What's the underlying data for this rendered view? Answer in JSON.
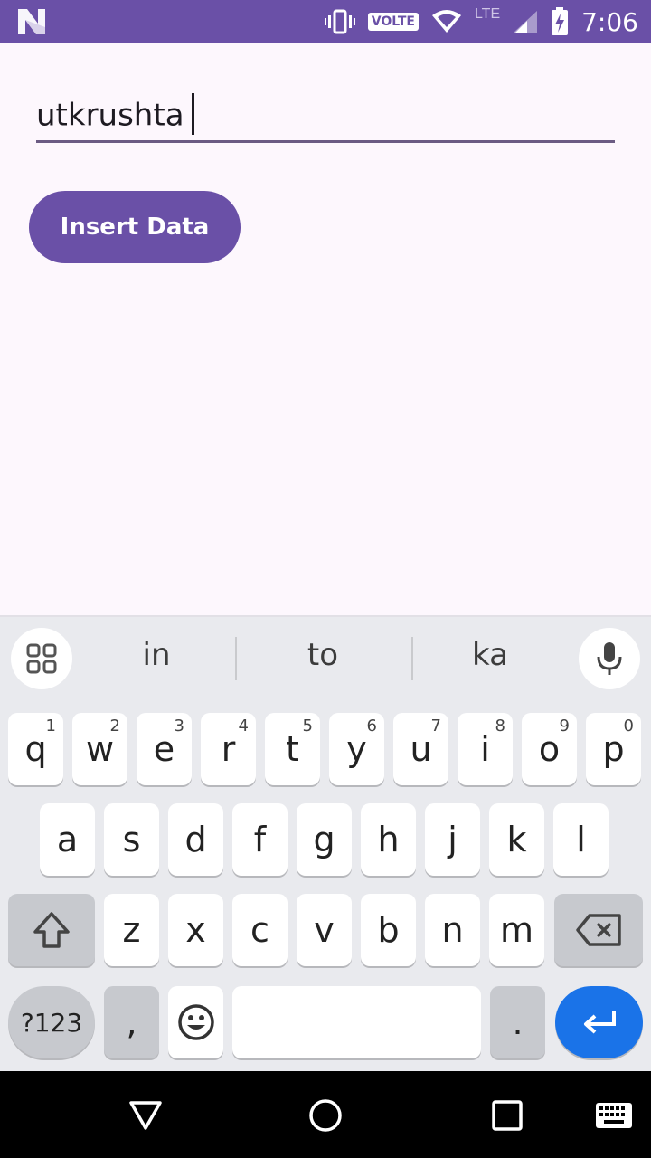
{
  "status_bar": {
    "clock": "7:06",
    "volte": "VOLTE",
    "network": "LTE",
    "icons": [
      "n-logo-icon",
      "vibrate-icon",
      "wifi-icon",
      "signal-icon",
      "battery-charging-icon"
    ]
  },
  "app": {
    "name_input": {
      "value": "utkrushta"
    },
    "insert_button": {
      "label": "Insert Data"
    },
    "accent": "#6A50A7",
    "background": "#FDF7FD"
  },
  "keyboard": {
    "suggestions": [
      "in",
      "to",
      "ka"
    ],
    "row1": [
      {
        "k": "q",
        "n": "1"
      },
      {
        "k": "w",
        "n": "2"
      },
      {
        "k": "e",
        "n": "3"
      },
      {
        "k": "r",
        "n": "4"
      },
      {
        "k": "t",
        "n": "5"
      },
      {
        "k": "y",
        "n": "6"
      },
      {
        "k": "u",
        "n": "7"
      },
      {
        "k": "i",
        "n": "8"
      },
      {
        "k": "o",
        "n": "9"
      },
      {
        "k": "p",
        "n": "0"
      }
    ],
    "row2": [
      "a",
      "s",
      "d",
      "f",
      "g",
      "h",
      "j",
      "k",
      "l"
    ],
    "row3": [
      "z",
      "x",
      "c",
      "v",
      "b",
      "n",
      "m"
    ],
    "symbols_label": "?123",
    "comma_label": ",",
    "period_label": ".",
    "enter_color": "#1A73E8"
  },
  "nav_bar": {
    "icons": [
      "back-icon",
      "home-icon",
      "recents-icon",
      "keyboard-switch-icon"
    ]
  }
}
